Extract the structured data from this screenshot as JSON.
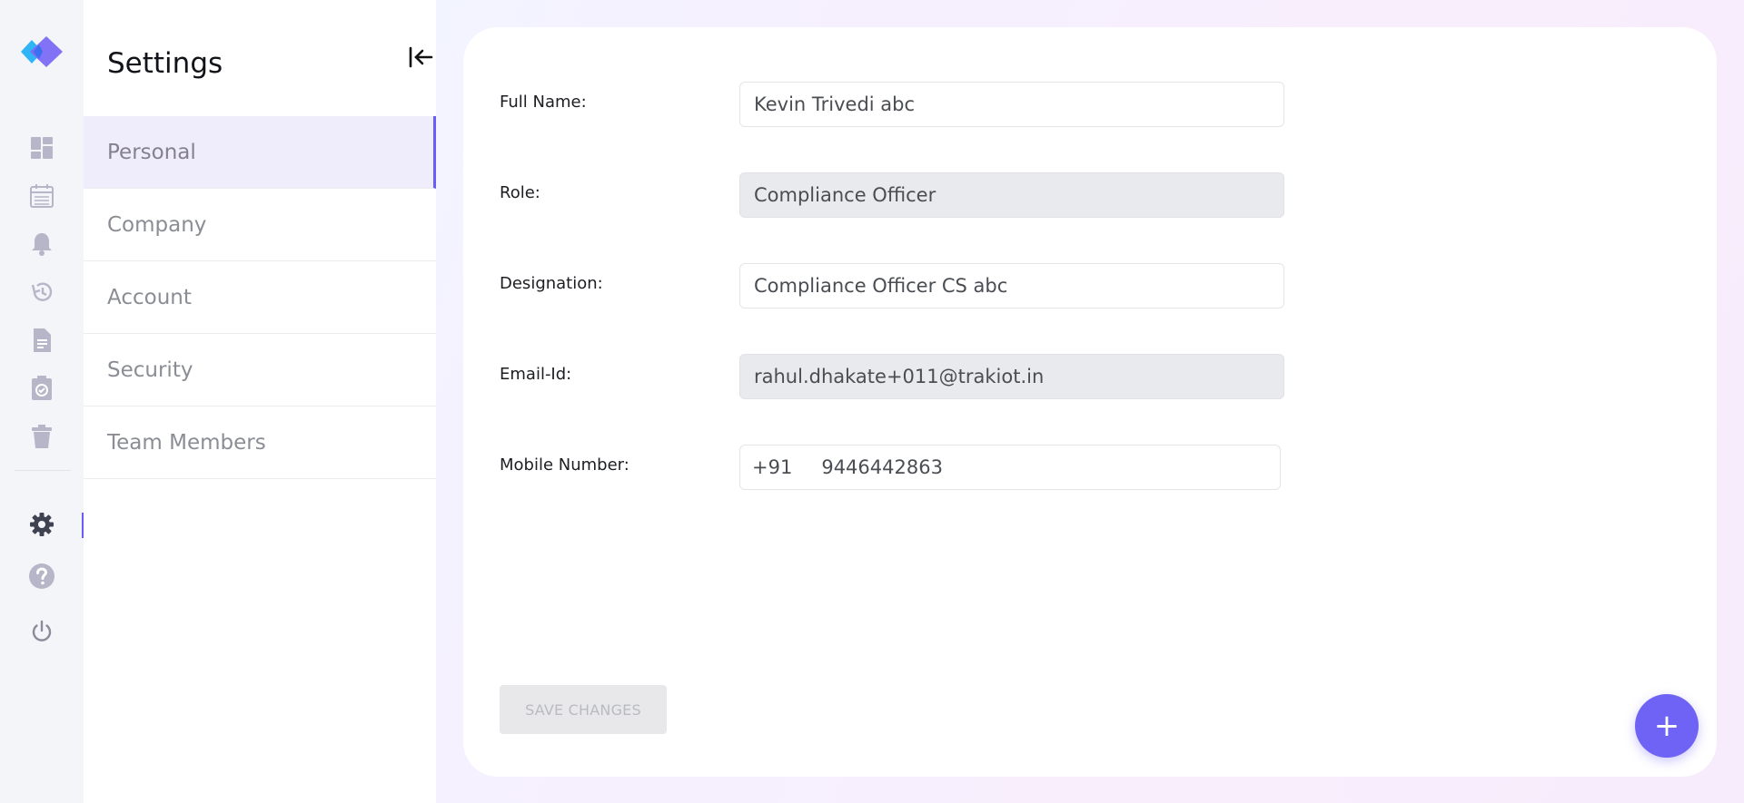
{
  "app": {
    "accent_color": "#6a5cf6"
  },
  "rail": {
    "icons": [
      "dashboard-icon",
      "calendar-icon",
      "bell-icon",
      "history-icon",
      "document-icon",
      "clipboard-check-icon",
      "trash-icon",
      "gear-icon",
      "help-icon",
      "power-icon"
    ],
    "active": "gear-icon"
  },
  "settings": {
    "title": "Settings",
    "menu": [
      {
        "label": "Personal",
        "active": true
      },
      {
        "label": "Company"
      },
      {
        "label": "Account"
      },
      {
        "label": "Security"
      },
      {
        "label": "Team Members"
      }
    ]
  },
  "form": {
    "full_name": {
      "label": "Full Name:",
      "value": "Kevin Trivedi abc"
    },
    "role": {
      "label": "Role:",
      "value": "Compliance Officer",
      "disabled": true
    },
    "designation": {
      "label": "Designation:",
      "value": "Compliance Officer CS abc"
    },
    "email": {
      "label": "Email-Id:",
      "value": "rahul.dhakate+011@trakiot.in",
      "disabled": true
    },
    "mobile": {
      "label": "Mobile Number:",
      "country_code": "+91",
      "value": "9446442863"
    },
    "save_label": "SAVE CHANGES"
  },
  "fab": {
    "label": "+"
  }
}
